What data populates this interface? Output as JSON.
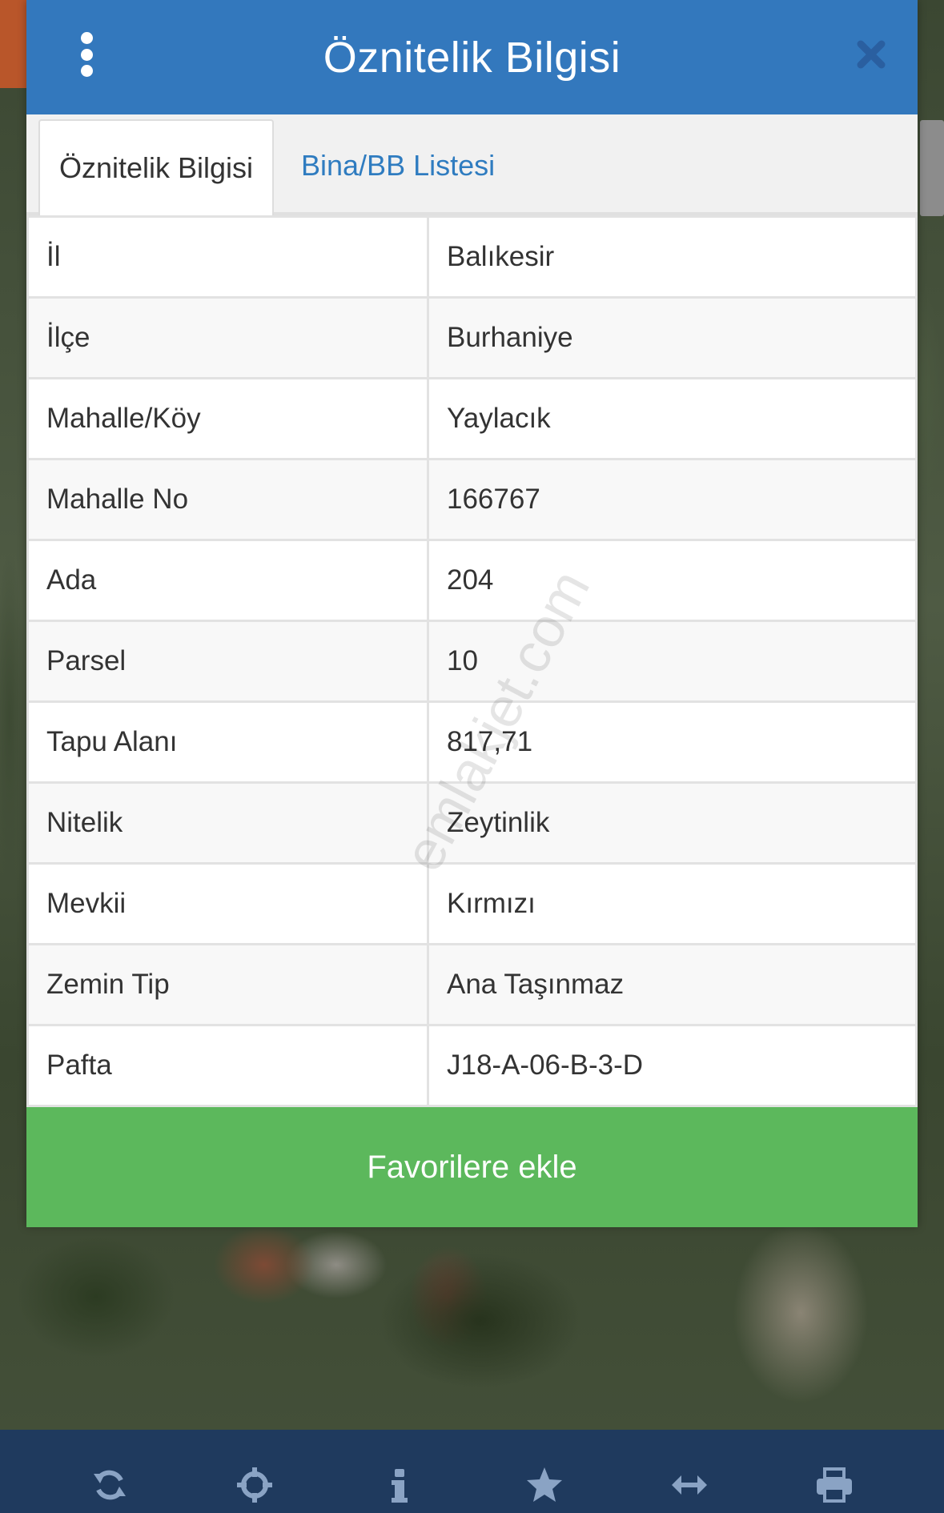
{
  "dialog": {
    "title": "Öznitelik Bilgisi",
    "accent_color": "#3378bd"
  },
  "tabs": [
    {
      "label": "Öznitelik Bilgisi",
      "active": true
    },
    {
      "label": "Bina/BB Listesi",
      "active": false
    }
  ],
  "attributes": [
    {
      "key": "İl",
      "value": "Balıkesir"
    },
    {
      "key": "İlçe",
      "value": "Burhaniye"
    },
    {
      "key": "Mahalle/Köy",
      "value": "Yaylacık"
    },
    {
      "key": "Mahalle No",
      "value": "166767"
    },
    {
      "key": "Ada",
      "value": "204"
    },
    {
      "key": "Parsel",
      "value": "10"
    },
    {
      "key": "Tapu Alanı",
      "value": "817,71"
    },
    {
      "key": "Nitelik",
      "value": "Zeytinlik"
    },
    {
      "key": "Mevkii",
      "value": "Kırmızı"
    },
    {
      "key": "Zemin Tip",
      "value": "Ana Taşınmaz"
    },
    {
      "key": "Pafta",
      "value": "J18-A-06-B-3-D"
    }
  ],
  "favorite_button": {
    "label": "Favorilere ekle",
    "color": "#5cb85c"
  },
  "watermark": "emlakjet.com",
  "toolbar": {
    "icons": [
      "refresh-icon",
      "crosshair-icon",
      "info-icon",
      "star-icon",
      "measure-icon",
      "print-icon"
    ]
  }
}
